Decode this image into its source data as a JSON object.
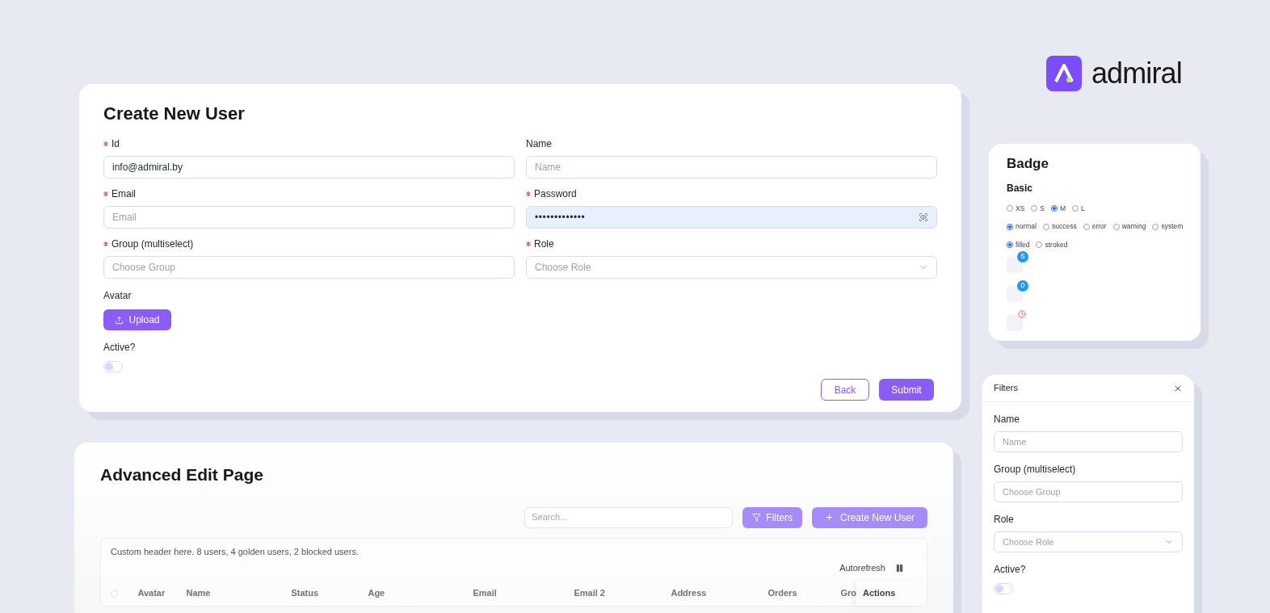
{
  "logo": {
    "text": "admiral"
  },
  "create_user": {
    "title": "Create New User",
    "fields": [
      {
        "label": "Id",
        "required": true,
        "kind": "text",
        "value": "info@admiral.by"
      },
      {
        "label": "Name",
        "required": false,
        "kind": "text",
        "placeholder": "Name"
      },
      {
        "label": "Email",
        "required": true,
        "kind": "text",
        "placeholder": "Email"
      },
      {
        "label": "Password",
        "required": true,
        "kind": "password",
        "value": "•••••••••••••"
      },
      {
        "label": "Group (multiselect)",
        "required": true,
        "kind": "text",
        "placeholder": "Choose Group"
      },
      {
        "label": "Role",
        "required": true,
        "kind": "select",
        "placeholder": "Choose Role"
      }
    ],
    "avatar_label": "Avatar",
    "upload_button": "Upload",
    "active_label": "Active?",
    "active": {
      "on": false
    },
    "buttons": [
      {
        "label": "Back",
        "kind": "outline"
      },
      {
        "label": "Submit",
        "kind": "primary"
      }
    ]
  },
  "badge_card": {
    "title": "Badge",
    "subtitle": "Basic",
    "radio_groups": [
      [
        {
          "label": "XS",
          "selected": false
        },
        {
          "label": "S",
          "selected": false
        },
        {
          "label": "M",
          "selected": true
        },
        {
          "label": "L",
          "selected": false
        }
      ],
      [
        {
          "label": "normal",
          "selected": true
        },
        {
          "label": "success",
          "selected": false
        },
        {
          "label": "error",
          "selected": false
        },
        {
          "label": "warning",
          "selected": false
        },
        {
          "label": "system",
          "selected": false
        }
      ],
      [
        {
          "label": "filled",
          "selected": true
        },
        {
          "label": "stroked",
          "selected": false
        }
      ]
    ],
    "badges": [
      {
        "kind": "count",
        "text": "5"
      },
      {
        "kind": "count",
        "text": "0"
      },
      {
        "kind": "clock"
      }
    ]
  },
  "filters": {
    "title": "Filters",
    "fields": [
      {
        "label": "Name",
        "kind": "text",
        "placeholder": "Name"
      },
      {
        "label": "Group (multiselect)",
        "kind": "text",
        "placeholder": "Choose Group"
      },
      {
        "label": "Role",
        "kind": "select",
        "placeholder": "Choose Role"
      }
    ],
    "active_label": "Active?",
    "active": {
      "on": false
    }
  },
  "advanced": {
    "title": "Advanced Edit Page",
    "search": {
      "placeholder": "Search..."
    },
    "filters_button": "Filters",
    "create_button": "Create New User",
    "header_text": "Custom header here. 8 users, 4 golden users, 2 blocked users.",
    "autorefresh": "Autorefresh",
    "columns": [
      "Avatar",
      "Name",
      "Status",
      "Age",
      "Email",
      "Email 2",
      "Address",
      "Orders",
      "Gro"
    ],
    "actions_column": "Actions",
    "select_all": {
      "checked": false
    }
  }
}
